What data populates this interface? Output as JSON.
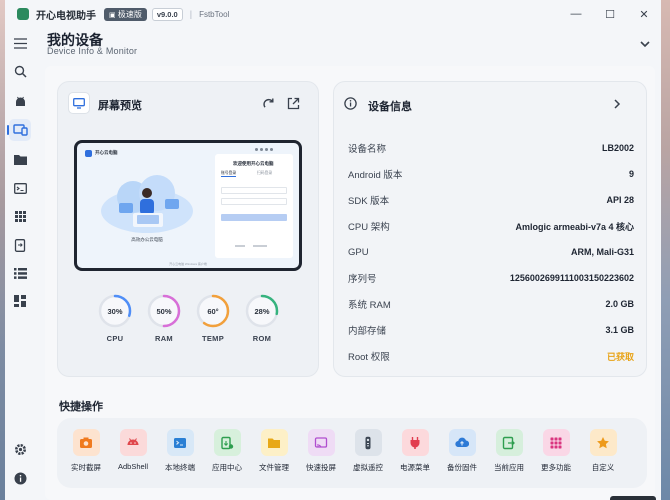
{
  "app": {
    "title": "开心电视助手",
    "edition": "极速版",
    "version": "v9.0.0",
    "brand": "FstbTool"
  },
  "window_controls": {
    "minimize": "—",
    "maximize": "☐",
    "close": "✕"
  },
  "sidebar": {
    "items": [
      {
        "icon": "menu-icon"
      },
      {
        "icon": "search-icon"
      },
      {
        "icon": "android-icon"
      },
      {
        "icon": "devices-icon",
        "active": true
      },
      {
        "icon": "folder-icon"
      },
      {
        "icon": "terminal-icon"
      },
      {
        "icon": "apps-grid-icon"
      },
      {
        "icon": "phone-transfer-icon"
      },
      {
        "icon": "list-icon"
      },
      {
        "icon": "dashboard-icon"
      }
    ],
    "bottom": [
      {
        "icon": "settings-icon"
      },
      {
        "icon": "info-icon"
      }
    ]
  },
  "page": {
    "title": "我的设备",
    "subtitle": "Device Info & Monitor"
  },
  "preview": {
    "title": "屏幕预览",
    "screen": {
      "app_name": "开心云电脑",
      "welcome": "欢迎使用开心云电脑",
      "tab_login": "账号登录",
      "tab_scan": "扫码登录",
      "caption": "高效办公云电脑",
      "footer": "开心云电脑 Windows 客户端"
    },
    "gauges": [
      {
        "label": "CPU",
        "value": "30%",
        "percent": 30,
        "color": "#4f8ef7"
      },
      {
        "label": "RAM",
        "value": "50%",
        "percent": 50,
        "color": "#d86fd8"
      },
      {
        "label": "TEMP",
        "value": "60°",
        "percent": 60,
        "color": "#f2a03b"
      },
      {
        "label": "ROM",
        "value": "28%",
        "percent": 28,
        "color": "#36b37e"
      }
    ]
  },
  "device": {
    "title": "设备信息",
    "rows": [
      {
        "key": "设备名称",
        "value": "LB2002"
      },
      {
        "key": "Android 版本",
        "value": "9"
      },
      {
        "key": "SDK 版本",
        "value": "API 28"
      },
      {
        "key": "CPU 架构",
        "value": "Amlogic armeabi-v7a 4 核心"
      },
      {
        "key": "GPU",
        "value": "ARM, Mali-G31"
      },
      {
        "key": "序列号",
        "value": "12560026991110031502236​02"
      },
      {
        "key": "系统 RAM",
        "value": "2.0 GB"
      },
      {
        "key": "内部存储",
        "value": "3.1 GB"
      },
      {
        "key": "Root 权限",
        "value": "已获取",
        "color": "#e8a317"
      }
    ]
  },
  "quick_actions": {
    "title": "快捷操作",
    "items": [
      {
        "label": "实时截屏",
        "icon": "camera-icon",
        "bg": "#fde3cf",
        "fg": "#f07a1e"
      },
      {
        "label": "AdbShell",
        "icon": "android-icon",
        "bg": "#fbdada",
        "fg": "#e0474c"
      },
      {
        "label": "本地终端",
        "icon": "terminal-icon",
        "bg": "#d8e8f7",
        "fg": "#2a7fd4"
      },
      {
        "label": "应用中心",
        "icon": "app-install-icon",
        "bg": "#d7f0dc",
        "fg": "#2e9e4f"
      },
      {
        "label": "文件管理",
        "icon": "folder-icon",
        "bg": "#fdf0c7",
        "fg": "#e8a817"
      },
      {
        "label": "快速投屏",
        "icon": "cast-icon",
        "bg": "#efdcf5",
        "fg": "#b04ecf"
      },
      {
        "label": "虚拟遥控",
        "icon": "remote-icon",
        "bg": "#dde3ea",
        "fg": "#3c4653"
      },
      {
        "label": "电源菜单",
        "icon": "power-plug-icon",
        "bg": "#fcd9dc",
        "fg": "#e23d4f"
      },
      {
        "label": "备份固件",
        "icon": "cloud-upload-icon",
        "bg": "#d6e6f8",
        "fg": "#2d7ad6"
      },
      {
        "label": "当前应用",
        "icon": "current-app-icon",
        "bg": "#d6efdc",
        "fg": "#2e9e4f"
      },
      {
        "label": "更多功能",
        "icon": "more-grid-icon",
        "bg": "#fad7e6",
        "fg": "#d9357f"
      },
      {
        "label": "自定义",
        "icon": "star-icon",
        "bg": "#fde9c9",
        "fg": "#ee9a1a"
      }
    ]
  }
}
